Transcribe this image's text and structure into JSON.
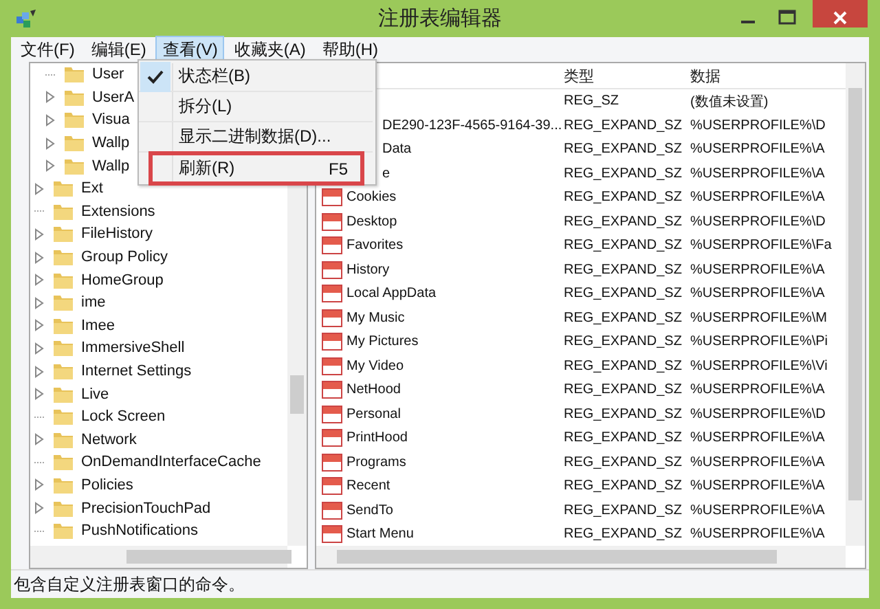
{
  "window": {
    "title": "注册表编辑器"
  },
  "menu_bar": [
    {
      "label": "文件(F)",
      "selected": false
    },
    {
      "label": "编辑(E)",
      "selected": false
    },
    {
      "label": "查看(V)",
      "selected": true
    },
    {
      "label": "收藏夹(A)",
      "selected": false
    },
    {
      "label": "帮助(H)",
      "selected": false
    }
  ],
  "dropdown": [
    {
      "label": "状态栏(B)",
      "checked": true,
      "highlighted": false
    },
    {
      "label": "拆分(L)",
      "checked": false,
      "highlighted": false
    },
    {
      "label": "显示二进制数据(D)...",
      "checked": false,
      "highlighted": false
    },
    {
      "label": "刷新(R)",
      "shortcut": "F5",
      "checked": false,
      "highlighted": true
    }
  ],
  "tree": {
    "items": [
      {
        "children": [
          {
            "label": "User",
            "expandable": false
          },
          {
            "label": "UserA",
            "expandable": true
          },
          {
            "label": "Visua",
            "expandable": true
          },
          {
            "label": "Wallp",
            "expandable": true
          },
          {
            "label": "Wallp",
            "expandable": true
          }
        ]
      },
      {
        "label": "Ext",
        "expandable": true
      },
      {
        "label": "Extensions",
        "expandable": false
      },
      {
        "label": "FileHistory",
        "expandable": true
      },
      {
        "label": "Group Policy",
        "expandable": true
      },
      {
        "label": "HomeGroup",
        "expandable": true
      },
      {
        "label": "ime",
        "expandable": true
      },
      {
        "label": "Imee",
        "expandable": true
      },
      {
        "label": "ImmersiveShell",
        "expandable": true
      },
      {
        "label": "Internet Settings",
        "expandable": true
      },
      {
        "label": "Live",
        "expandable": true
      },
      {
        "label": "Lock Screen",
        "expandable": false
      },
      {
        "label": "Network",
        "expandable": true
      },
      {
        "label": "OnDemandInterfaceCache",
        "expandable": false
      },
      {
        "label": "Policies",
        "expandable": true
      },
      {
        "label": "PrecisionTouchPad",
        "expandable": true
      },
      {
        "label": "PushNotifications",
        "expandable": false
      }
    ]
  },
  "table": {
    "columns": [
      "类型",
      "数据"
    ],
    "rows": [
      {
        "icon": false,
        "type": "REG_SZ",
        "data": "(数值未设置)"
      },
      {
        "icon": false,
        "name": "DE290-123F-4565-9164-39...",
        "type": "REG_EXPAND_SZ",
        "data": "%USERPROFILE%\\D"
      },
      {
        "icon": false,
        "name": "Data",
        "type": "REG_EXPAND_SZ",
        "data": "%USERPROFILE%\\A"
      },
      {
        "icon": false,
        "name": "e",
        "type": "REG_EXPAND_SZ",
        "data": "%USERPROFILE%\\A"
      },
      {
        "icon": true,
        "name": "Cookies",
        "type": "REG_EXPAND_SZ",
        "data": "%USERPROFILE%\\A"
      },
      {
        "icon": true,
        "name": "Desktop",
        "type": "REG_EXPAND_SZ",
        "data": "%USERPROFILE%\\D"
      },
      {
        "icon": true,
        "name": "Favorites",
        "type": "REG_EXPAND_SZ",
        "data": "%USERPROFILE%\\Fa"
      },
      {
        "icon": true,
        "name": "History",
        "type": "REG_EXPAND_SZ",
        "data": "%USERPROFILE%\\A"
      },
      {
        "icon": true,
        "name": "Local AppData",
        "type": "REG_EXPAND_SZ",
        "data": "%USERPROFILE%\\A"
      },
      {
        "icon": true,
        "name": "My Music",
        "type": "REG_EXPAND_SZ",
        "data": "%USERPROFILE%\\M"
      },
      {
        "icon": true,
        "name": "My Pictures",
        "type": "REG_EXPAND_SZ",
        "data": "%USERPROFILE%\\Pi"
      },
      {
        "icon": true,
        "name": "My Video",
        "type": "REG_EXPAND_SZ",
        "data": "%USERPROFILE%\\Vi"
      },
      {
        "icon": true,
        "name": "NetHood",
        "type": "REG_EXPAND_SZ",
        "data": "%USERPROFILE%\\A"
      },
      {
        "icon": true,
        "name": "Personal",
        "type": "REG_EXPAND_SZ",
        "data": "%USERPROFILE%\\D"
      },
      {
        "icon": true,
        "name": "PrintHood",
        "type": "REG_EXPAND_SZ",
        "data": "%USERPROFILE%\\A"
      },
      {
        "icon": true,
        "name": "Programs",
        "type": "REG_EXPAND_SZ",
        "data": "%USERPROFILE%\\A"
      },
      {
        "icon": true,
        "name": "Recent",
        "type": "REG_EXPAND_SZ",
        "data": "%USERPROFILE%\\A"
      },
      {
        "icon": true,
        "name": "SendTo",
        "type": "REG_EXPAND_SZ",
        "data": "%USERPROFILE%\\A"
      },
      {
        "icon": true,
        "name": "Start Menu",
        "type": "REG_EXPAND_SZ",
        "data": "%USERPROFILE%\\A"
      }
    ]
  },
  "status_bar": "包含自定义注册表窗口的命令。"
}
